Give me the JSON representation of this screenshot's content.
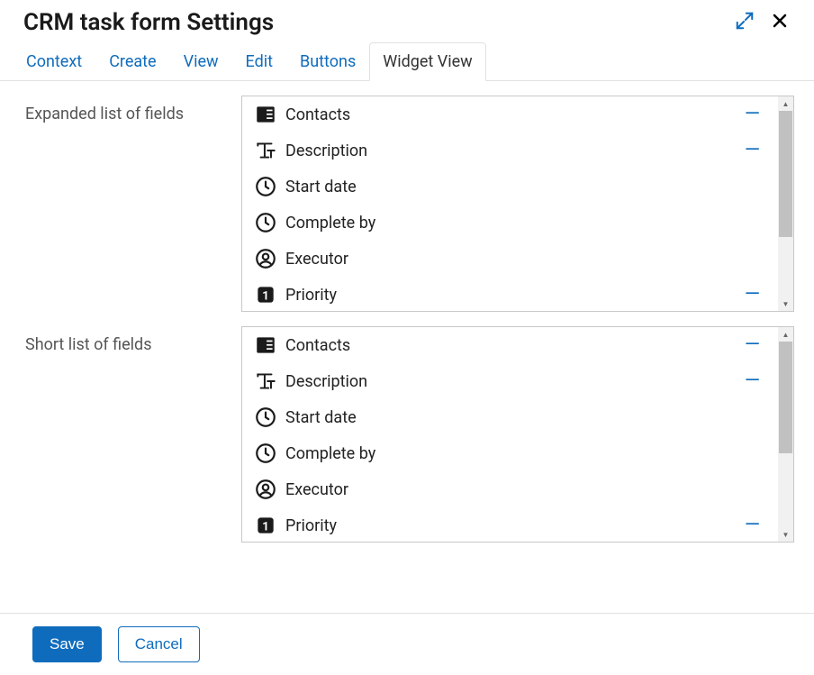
{
  "header": {
    "title": "CRM task form Settings"
  },
  "tabs": [
    {
      "id": "context",
      "label": "Context"
    },
    {
      "id": "create",
      "label": "Create"
    },
    {
      "id": "view",
      "label": "View"
    },
    {
      "id": "edit",
      "label": "Edit"
    },
    {
      "id": "buttons",
      "label": "Buttons"
    },
    {
      "id": "widget",
      "label": "Widget View"
    }
  ],
  "activeTab": "widget",
  "sections": {
    "expanded": {
      "label": "Expanded list of fields",
      "fields": [
        {
          "icon": "contacts",
          "label": "Contacts",
          "removable": true
        },
        {
          "icon": "text",
          "label": "Description",
          "removable": true
        },
        {
          "icon": "clock",
          "label": "Start date",
          "removable": false
        },
        {
          "icon": "clock",
          "label": "Complete by",
          "removable": false
        },
        {
          "icon": "person",
          "label": "Executor",
          "removable": false
        },
        {
          "icon": "priority",
          "label": "Priority",
          "removable": true
        }
      ]
    },
    "short": {
      "label": "Short list of fields",
      "fields": [
        {
          "icon": "contacts",
          "label": "Contacts",
          "removable": true
        },
        {
          "icon": "text",
          "label": "Description",
          "removable": true
        },
        {
          "icon": "clock",
          "label": "Start date",
          "removable": false
        },
        {
          "icon": "clock",
          "label": "Complete by",
          "removable": false
        },
        {
          "icon": "person",
          "label": "Executor",
          "removable": false
        },
        {
          "icon": "priority",
          "label": "Priority",
          "removable": true
        }
      ]
    }
  },
  "footer": {
    "save": "Save",
    "cancel": "Cancel"
  }
}
